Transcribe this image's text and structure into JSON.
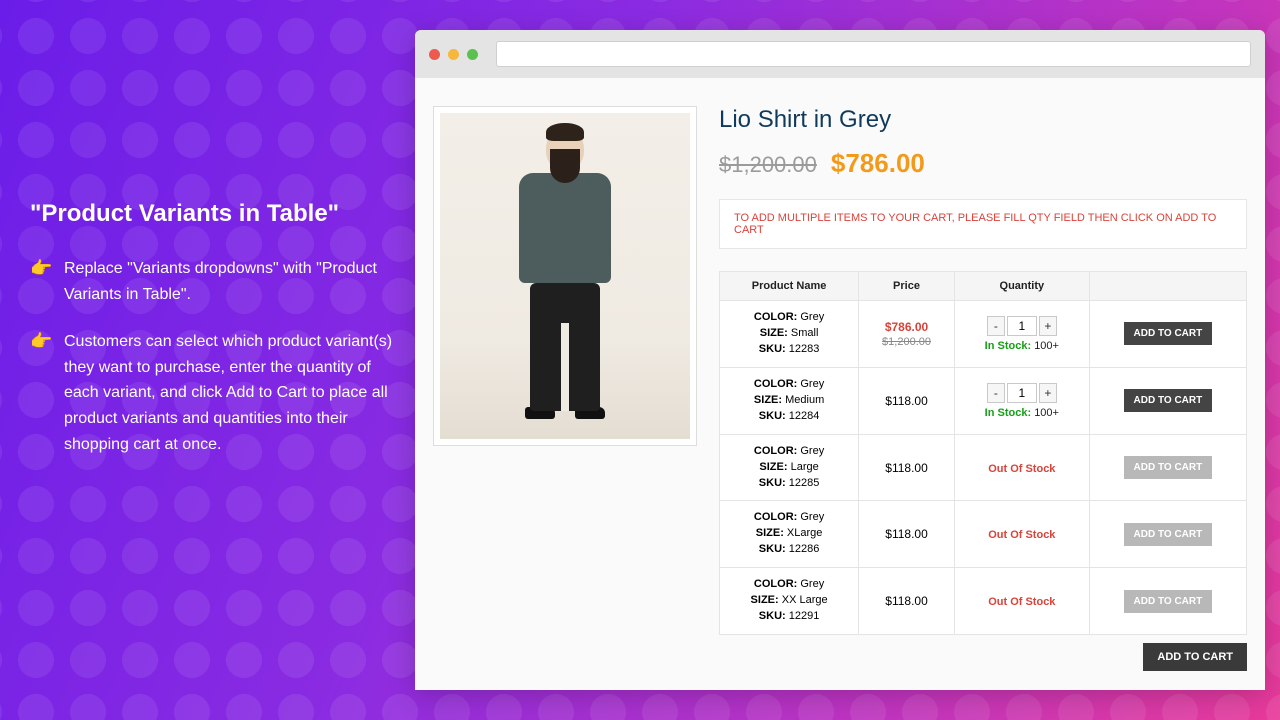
{
  "promo": {
    "title": "\"Product Variants in Table\"",
    "bullets": [
      "Replace \"Variants dropdowns\" with \"Product Variants in Table\".",
      "Customers can select which product variant(s) they want to purchase, enter the quantity of each variant, and click Add to Cart to place all product variants and quantities into their shopping cart at once."
    ]
  },
  "product": {
    "title": "Lio Shirt in Grey",
    "original_price": "$1,200.00",
    "sale_price": "$786.00",
    "notice": "TO ADD MULTIPLE ITEMS TO YOUR CART, PLEASE FILL QTY FIELD THEN CLICK ON ADD TO CART"
  },
  "table": {
    "headers": {
      "name": "Product Name",
      "price": "Price",
      "qty": "Quantity",
      "action": ""
    },
    "attr_labels": {
      "color": "COLOR:",
      "size": "SIZE:",
      "sku": "SKU:"
    },
    "stock_labels": {
      "in": "In Stock:",
      "out": "Out Of Stock"
    },
    "qty_default": "1",
    "add_label": "ADD TO CART",
    "footer_add_label": "ADD TO CART",
    "rows": [
      {
        "color": "Grey",
        "size": "Small",
        "sku": "12283",
        "price": "$786.00",
        "original": "$1,200.00",
        "in_stock": true,
        "stock_qty": "100+"
      },
      {
        "color": "Grey",
        "size": "Medium",
        "sku": "12284",
        "price": "$118.00",
        "original": null,
        "in_stock": true,
        "stock_qty": "100+"
      },
      {
        "color": "Grey",
        "size": "Large",
        "sku": "12285",
        "price": "$118.00",
        "original": null,
        "in_stock": false,
        "stock_qty": null
      },
      {
        "color": "Grey",
        "size": "XLarge",
        "sku": "12286",
        "price": "$118.00",
        "original": null,
        "in_stock": false,
        "stock_qty": null
      },
      {
        "color": "Grey",
        "size": "XX Large",
        "sku": "12291",
        "price": "$118.00",
        "original": null,
        "in_stock": false,
        "stock_qty": null
      }
    ]
  }
}
